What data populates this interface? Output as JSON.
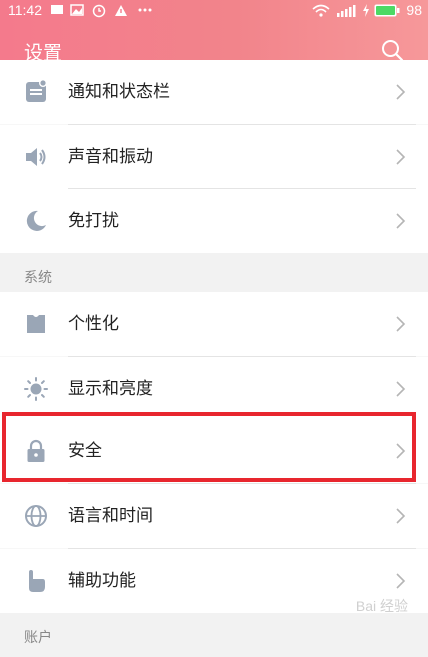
{
  "status_bar": {
    "time": "11:42",
    "battery": "98"
  },
  "header": {
    "title": "设置"
  },
  "items": [
    {
      "label": "通知和状态栏",
      "icon": "notification-icon"
    },
    {
      "label": "声音和振动",
      "icon": "speaker-icon"
    },
    {
      "label": "免打扰",
      "icon": "moon-icon"
    },
    {
      "label": "个性化",
      "icon": "shirt-icon"
    },
    {
      "label": "显示和亮度",
      "icon": "brightness-icon"
    },
    {
      "label": "安全",
      "icon": "lock-icon"
    },
    {
      "label": "语言和时间",
      "icon": "globe-icon"
    },
    {
      "label": "辅助功能",
      "icon": "hand-icon"
    }
  ],
  "sections": {
    "system": "系统",
    "account": "账户"
  },
  "watermark": "Bai 经验",
  "colors": {
    "header": "#f47a8c",
    "icon": "#9aa6b6",
    "highlight": "#e8262e"
  }
}
